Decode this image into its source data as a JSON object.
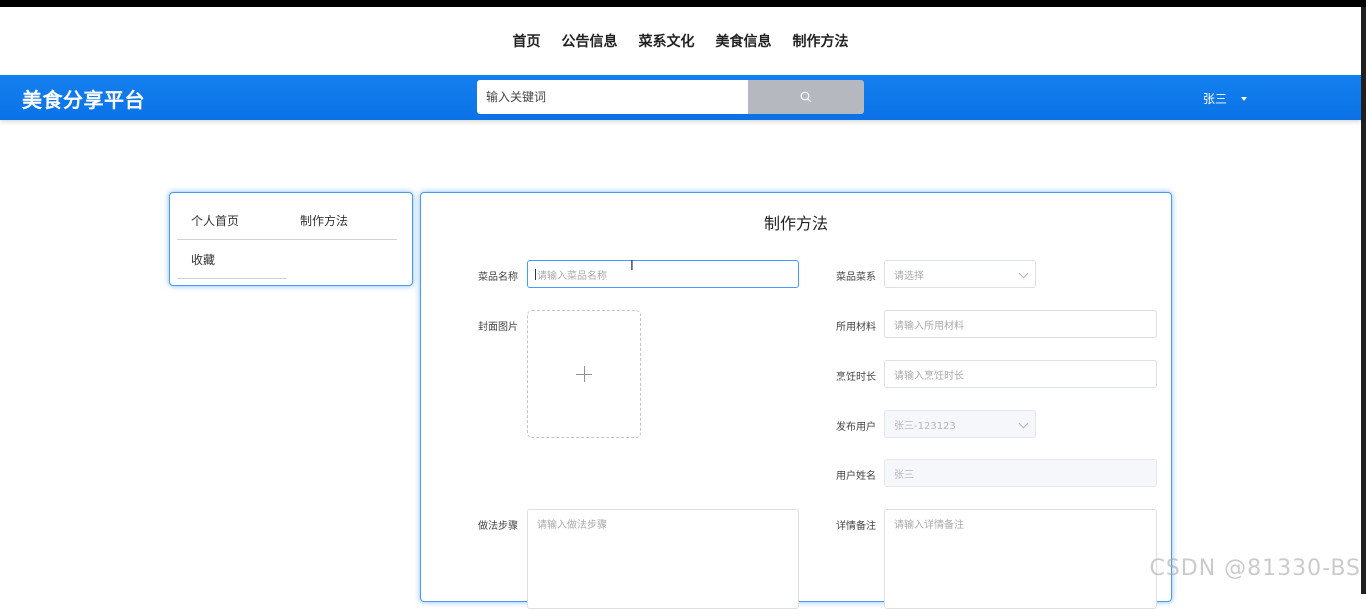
{
  "topnav": {
    "items": [
      {
        "label": "首页"
      },
      {
        "label": "公告信息"
      },
      {
        "label": "菜系文化"
      },
      {
        "label": "美食信息"
      },
      {
        "label": "制作方法"
      }
    ]
  },
  "header": {
    "brand": "美食分享平台",
    "search": {
      "placeholder": "输入关键词",
      "icon": "search-icon"
    },
    "user": {
      "name": "张三",
      "icon": "caret-down-icon"
    },
    "accent_color": "#1580f0"
  },
  "sidebar": {
    "items": [
      {
        "label": "个人首页"
      },
      {
        "label": "制作方法"
      },
      {
        "label": "收藏"
      }
    ]
  },
  "form": {
    "title": "制作方法",
    "dish_name": {
      "label": "菜品名称",
      "placeholder": "请输入菜品名称"
    },
    "cuisine": {
      "label": "菜品菜系",
      "placeholder": "请选择"
    },
    "cover": {
      "label": "封面图片",
      "icon": "plus-icon"
    },
    "materials": {
      "label": "所用材料",
      "placeholder": "请输入所用材料"
    },
    "cook_time": {
      "label": "烹饪时长",
      "placeholder": "请输入烹饪时长"
    },
    "publisher": {
      "label": "发布用户",
      "value": "张三-123123"
    },
    "user_name": {
      "label": "用户姓名",
      "value": "张三"
    },
    "steps": {
      "label": "做法步骤",
      "placeholder": "请输入做法步骤"
    },
    "remarks": {
      "label": "详情备注",
      "placeholder": "请输入详情备注"
    }
  },
  "watermark": "CSDN @81330-BS"
}
